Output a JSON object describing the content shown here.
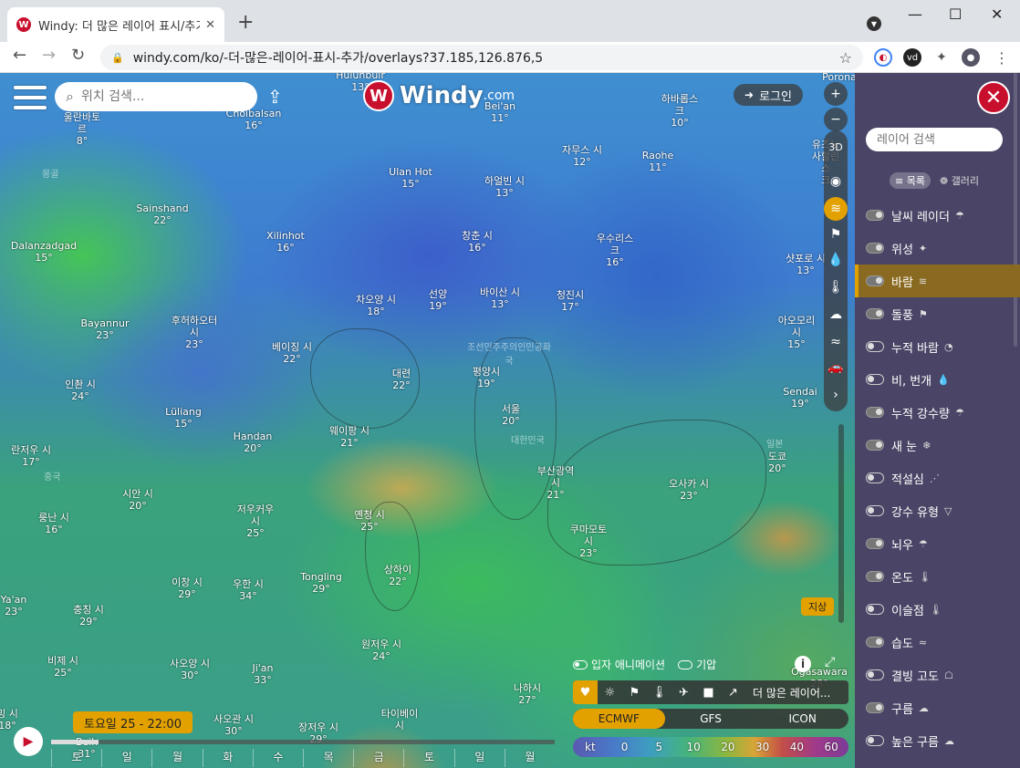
{
  "browser": {
    "tab_title": "Windy: 더 많은 레이어 표시/추가",
    "tab_close": "✕",
    "new_tab": "+",
    "url": "windy.com/ko/-더-많은-레이어-표시-추가/overlays?37.185,126.876,5",
    "controls": {
      "minimize": "—",
      "maximize": "☐",
      "close": "✕"
    }
  },
  "map": {
    "search_placeholder": "위치 검색...",
    "logo_text": "Windy",
    "logo_suffix": ".com",
    "login_label": "로그인",
    "zoom_in": "+",
    "zoom_out": "−",
    "btn_3d": "3D",
    "ground_label": "지상",
    "cities": [
      {
        "name": "Hulunbuir",
        "temp": "13°"
      },
      {
        "name": "Porona",
        "temp": ""
      },
      {
        "name": "울란바토\n르",
        "temp": "8°"
      },
      {
        "name": "Choibalsan",
        "temp": "16°"
      },
      {
        "name": "Bei'an",
        "temp": "11°"
      },
      {
        "name": "하바롭스\n크",
        "temp": "10°"
      },
      {
        "name": "유즈노사할린스\n크",
        "temp": ""
      },
      {
        "name": "자무스 시",
        "temp": "12°"
      },
      {
        "name": "Raohe",
        "temp": "11°"
      },
      {
        "name": "Ulan Hot",
        "temp": "15°"
      },
      {
        "name": "하얼빈 시",
        "temp": "13°"
      },
      {
        "name": "Sainshand",
        "temp": "22°"
      },
      {
        "name": "Xilinhot",
        "temp": "16°"
      },
      {
        "name": "창춘 시",
        "temp": "16°"
      },
      {
        "name": "우수리스\n크",
        "temp": "16°"
      },
      {
        "name": "샷포로 시",
        "temp": "13°"
      },
      {
        "name": "Dalanzadgad",
        "temp": "15°"
      },
      {
        "name": "차오양 시",
        "temp": "18°"
      },
      {
        "name": "선양",
        "temp": "19°"
      },
      {
        "name": "바이산 시",
        "temp": "13°"
      },
      {
        "name": "청진시",
        "temp": "17°"
      },
      {
        "name": "아오모리\n시",
        "temp": "15°"
      },
      {
        "name": "Bayannur",
        "temp": "23°"
      },
      {
        "name": "후허하오터\n시",
        "temp": "23°"
      },
      {
        "name": "베이징 시",
        "temp": "22°"
      },
      {
        "name": "대련",
        "temp": "22°"
      },
      {
        "name": "평양시",
        "temp": "19°"
      },
      {
        "name": "Sendai",
        "temp": "19°"
      },
      {
        "name": "인촨 시",
        "temp": "24°"
      },
      {
        "name": "Lüliang",
        "temp": "15°"
      },
      {
        "name": "서울",
        "temp": "20°"
      },
      {
        "name": "Handan",
        "temp": "20°"
      },
      {
        "name": "웨이팡 시",
        "temp": "21°"
      },
      {
        "name": "도쿄",
        "temp": "20°"
      },
      {
        "name": "란저우 시",
        "temp": "17°"
      },
      {
        "name": "부산광역\n시",
        "temp": "21°"
      },
      {
        "name": "오사카 시",
        "temp": "23°"
      },
      {
        "name": "시안 시",
        "temp": "20°"
      },
      {
        "name": "룽난 시",
        "temp": "16°"
      },
      {
        "name": "저우커우\n시",
        "temp": "25°"
      },
      {
        "name": "옌청 시",
        "temp": "25°"
      },
      {
        "name": "쿠마모토\n시",
        "temp": "23°"
      },
      {
        "name": "Ya'an",
        "temp": "23°"
      },
      {
        "name": "이창 시",
        "temp": "29°"
      },
      {
        "name": "우한 시",
        "temp": "34°"
      },
      {
        "name": "Tongling",
        "temp": "29°"
      },
      {
        "name": "상하이",
        "temp": "22°"
      },
      {
        "name": "충칭 시",
        "temp": "29°"
      },
      {
        "name": "비제 시",
        "temp": "25°"
      },
      {
        "name": "사오양 시",
        "temp": "30°"
      },
      {
        "name": "Ji'an",
        "temp": "33°"
      },
      {
        "name": "원저우 시",
        "temp": "24°"
      },
      {
        "name": "Ogasawara",
        "temp": "28°"
      },
      {
        "name": "나하시",
        "temp": "27°"
      },
      {
        "name": "밍 시",
        "temp": "18°"
      },
      {
        "name": "사오관 시",
        "temp": "30°"
      },
      {
        "name": "장저우 시",
        "temp": "29°"
      },
      {
        "name": "타이베이\n시",
        "temp": ""
      },
      {
        "name": "Beih",
        "temp": "31°"
      }
    ],
    "regions": [
      "몽골",
      "조선민주주의인민공화\n국",
      "대한민국",
      "중국",
      "일본"
    ],
    "animation_label": "입자 애니메이션",
    "pressure_label": "기압",
    "more_layers_label": "더 많은 레이어...",
    "models": [
      "ECMWF",
      "GFS",
      "ICON"
    ],
    "active_model": "ECMWF",
    "legend_unit": "kt",
    "legend_values": [
      "0",
      "5",
      "10",
      "20",
      "30",
      "40",
      "60"
    ],
    "time_label": "토요일 25 - 22:00",
    "days": [
      "토",
      "일",
      "월",
      "화",
      "수",
      "목",
      "금",
      "토",
      "일",
      "월"
    ]
  },
  "panel": {
    "close": "✕",
    "search_placeholder": "레이어 검색",
    "view_list": "목록",
    "view_gallery": "갤러리",
    "layers": [
      {
        "label": "날씨 레이더",
        "on": true
      },
      {
        "label": "위성",
        "on": true
      },
      {
        "label": "바람",
        "on": true,
        "active": true
      },
      {
        "label": "돌풍",
        "on": true
      },
      {
        "label": "누적 바람",
        "on": false
      },
      {
        "label": "비, 번개",
        "on": false
      },
      {
        "label": "누적 강수량",
        "on": true
      },
      {
        "label": "새 눈",
        "on": true
      },
      {
        "label": "적설심",
        "on": false
      },
      {
        "label": "강수 유형",
        "on": false
      },
      {
        "label": "뇌우",
        "on": true
      },
      {
        "label": "온도",
        "on": true
      },
      {
        "label": "이슬점",
        "on": false
      },
      {
        "label": "습도",
        "on": true
      },
      {
        "label": "결빙 고도",
        "on": false
      },
      {
        "label": "구름",
        "on": true
      },
      {
        "label": "높은 구름",
        "on": false
      }
    ]
  },
  "colors": {
    "accent": "#e3a100",
    "brand": "#c8102e",
    "panel": "#4a4566"
  }
}
